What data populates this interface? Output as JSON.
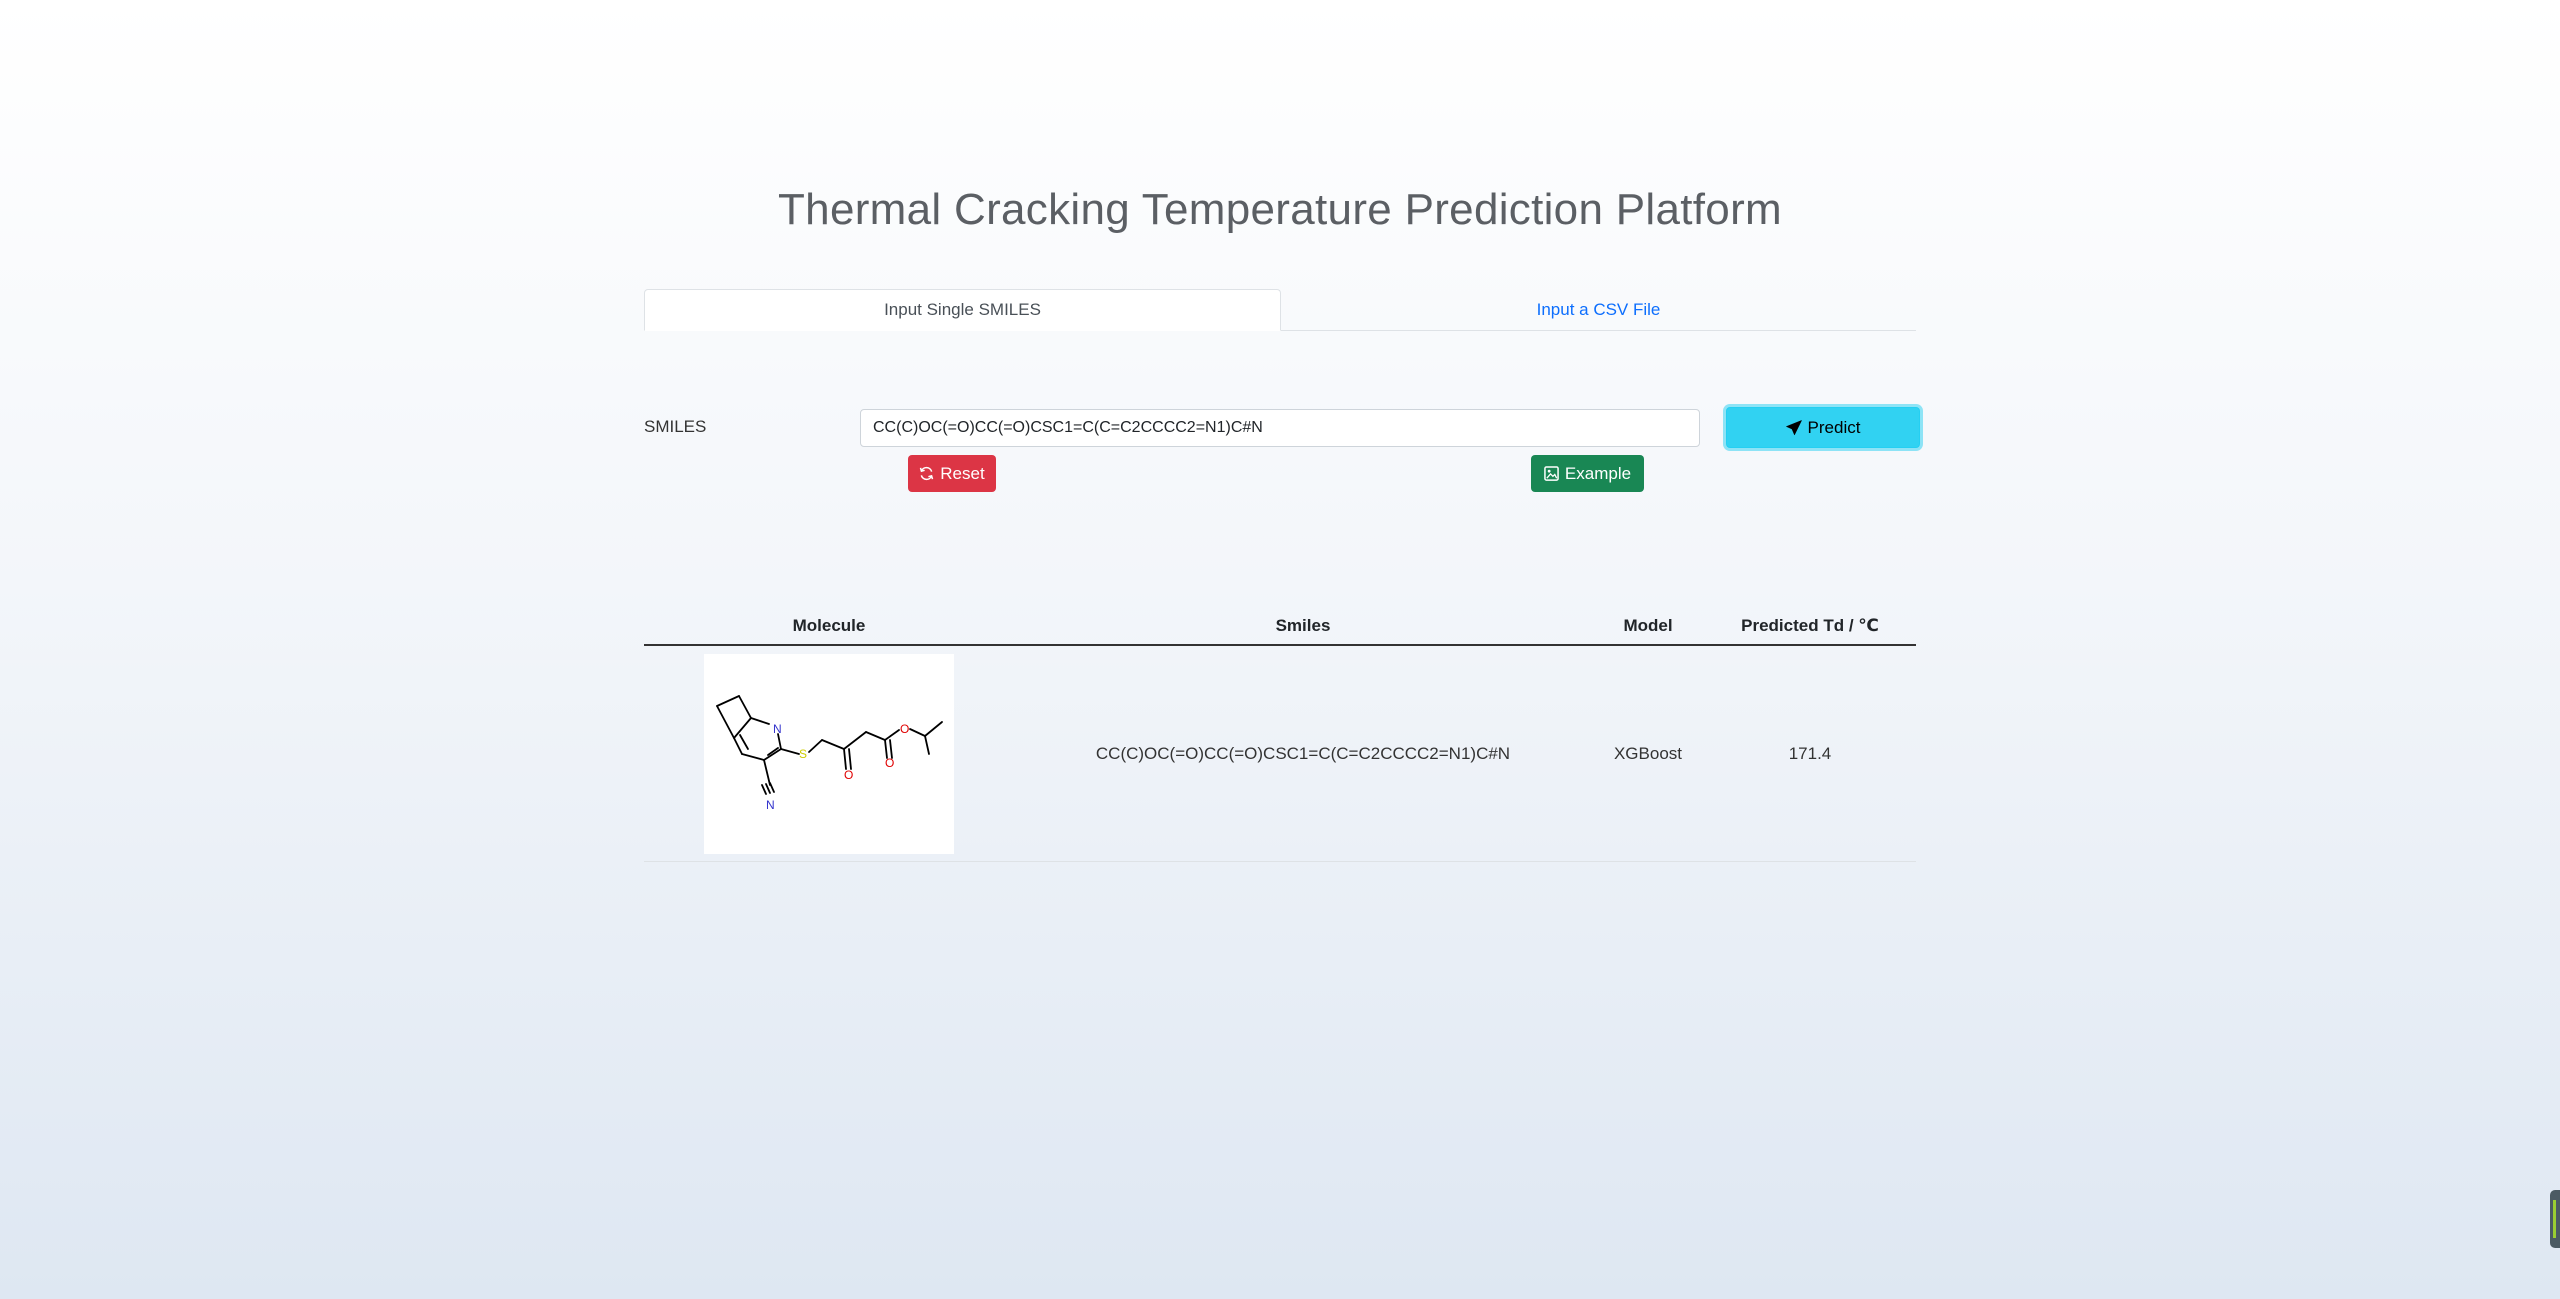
{
  "page": {
    "title": "Thermal Cracking Temperature Prediction Platform"
  },
  "tabs": [
    {
      "label": "Input Single SMILES",
      "active": true
    },
    {
      "label": "Input a CSV File",
      "active": false
    }
  ],
  "form": {
    "smiles_label": "SMILES",
    "smiles_value": "CC(C)OC(=O)CC(=O)CSC1=C(C=C2CCCC2=N1)C#N",
    "predict_label": "Predict",
    "predict_icon": "send-icon",
    "reset_label": "Reset",
    "reset_icon": "refresh-icon",
    "example_label": "Example",
    "example_icon": "image-icon"
  },
  "table": {
    "headers": [
      "Molecule",
      "Smiles",
      "Model",
      "Predicted Td / ℃"
    ],
    "rows": [
      {
        "molecule_atoms": [
          "N",
          "S",
          "O",
          "O",
          "O",
          "N"
        ],
        "smiles": "CC(C)OC(=O)CC(=O)CSC1=C(C=C2CCCC2=N1)C#N",
        "model": "XGBoost",
        "predicted_td": "171.4"
      }
    ]
  },
  "colors": {
    "predict": "#31d2f2",
    "reset": "#dc3545",
    "example": "#198754",
    "link": "#0d6efd",
    "nitrogen": "#3333cc",
    "oxygen": "#e00000",
    "sulfur": "#cccc00"
  }
}
